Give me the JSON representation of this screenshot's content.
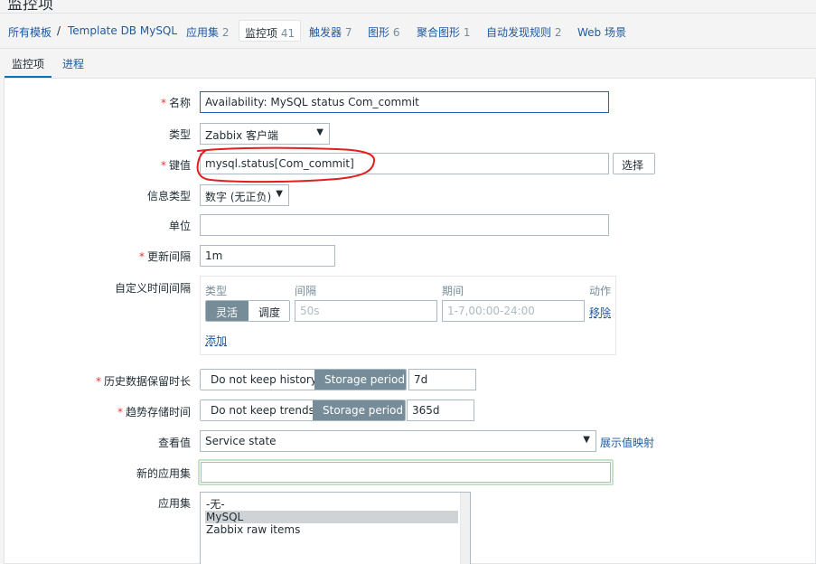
{
  "page": {
    "title": "监控项"
  },
  "breadcrumb": {
    "all_templates": "所有模板",
    "separator": "/",
    "template": "Template DB MySQL",
    "applications": {
      "label": "应用集",
      "count": "2"
    },
    "items": {
      "label": "监控项",
      "count": "41"
    },
    "triggers": {
      "label": "触发器",
      "count": "7"
    },
    "graphs": {
      "label": "图形",
      "count": "6"
    },
    "screens": {
      "label": "聚合图形",
      "count": "1"
    },
    "discovery": {
      "label": "自动发现规则",
      "count": "2"
    },
    "web": {
      "label": "Web 场景"
    }
  },
  "tabs": {
    "item": "监控项",
    "process": "进程"
  },
  "form": {
    "name": {
      "label": "名称",
      "value": "Availability: MySQL status Com_commit"
    },
    "type": {
      "label": "类型",
      "value": "Zabbix 客户端"
    },
    "key": {
      "label": "键值",
      "value": "mysql.status[Com_commit]",
      "select_button": "选择"
    },
    "value_type": {
      "label": "信息类型",
      "value": "数字 (无正负)"
    },
    "units": {
      "label": "单位",
      "value": ""
    },
    "update_interval": {
      "label": "更新间隔",
      "value": "1m"
    },
    "custom_intervals": {
      "label": "自定义时间间隔",
      "col_type": "类型",
      "col_interval": "间隔",
      "col_period": "期间",
      "col_action": "动作",
      "flexible": "灵活",
      "scheduling": "调度",
      "interval_placeholder": "50s",
      "period_placeholder": "1-7,00:00-24:00",
      "remove": "移除",
      "add": "添加"
    },
    "history": {
      "label": "历史数据保留时长",
      "no_keep": "Do not keep history",
      "storage": "Storage period",
      "value": "7d"
    },
    "trends": {
      "label": "趋势存储时间",
      "no_keep": "Do not keep trends",
      "storage": "Storage period",
      "value": "365d"
    },
    "show_value": {
      "label": "查看值",
      "value": "Service state",
      "mapping_link": "展示值映射"
    },
    "new_application": {
      "label": "新的应用集",
      "value": ""
    },
    "applications": {
      "label": "应用集",
      "options": [
        "-无-",
        "MySQL",
        "Zabbix raw items"
      ],
      "selected": "MySQL"
    }
  },
  "colors": {
    "link": "#1f5aa0",
    "required": "#e33734",
    "segment_active": "#768d99",
    "annotation": "#e02020",
    "tab_underline": "#0275b8"
  },
  "icons": {
    "dropdown": "caret-down-icon"
  }
}
